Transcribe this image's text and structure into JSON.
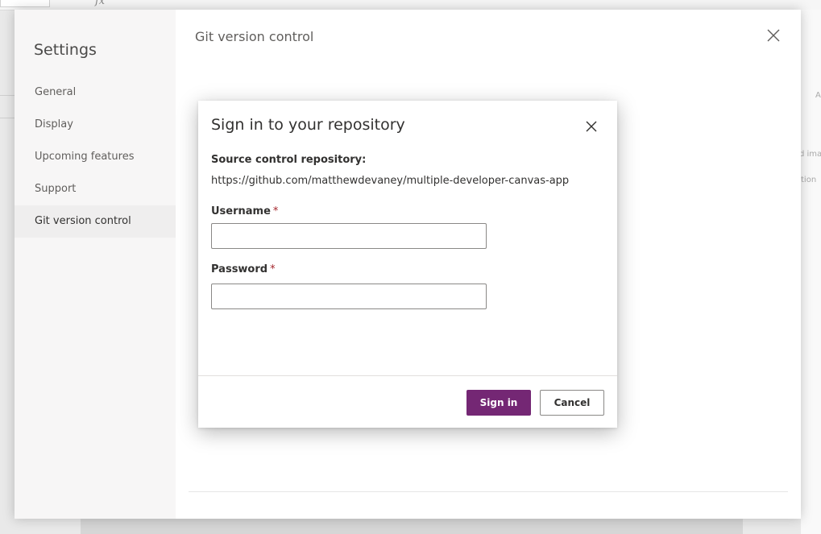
{
  "background": {
    "fx_label": "fx",
    "right_panel_text": [
      "A",
      "d ima",
      "tion"
    ]
  },
  "settings": {
    "title": "Settings",
    "nav_items": [
      {
        "label": "General",
        "active": false
      },
      {
        "label": "Display",
        "active": false
      },
      {
        "label": "Upcoming features",
        "active": false
      },
      {
        "label": "Support",
        "active": false
      },
      {
        "label": "Git version control",
        "active": true
      }
    ],
    "main_title": "Git version control",
    "close_icon": "close-icon"
  },
  "dialog": {
    "title": "Sign in to your repository",
    "close_icon": "close-icon",
    "repo_label": "Source control repository:",
    "repo_url": "https://github.com/matthewdevaney/multiple-developer-canvas-app",
    "username": {
      "label": "Username",
      "required_mark": "*",
      "value": "",
      "placeholder": ""
    },
    "password": {
      "label": "Password",
      "required_mark": "*",
      "value": "",
      "placeholder": ""
    },
    "sign_in_label": "Sign in",
    "cancel_label": "Cancel"
  },
  "colors": {
    "accent": "#742774",
    "required": "#a4262c",
    "nav_background": "#f7f6f6",
    "nav_active_background": "#efeeee"
  }
}
